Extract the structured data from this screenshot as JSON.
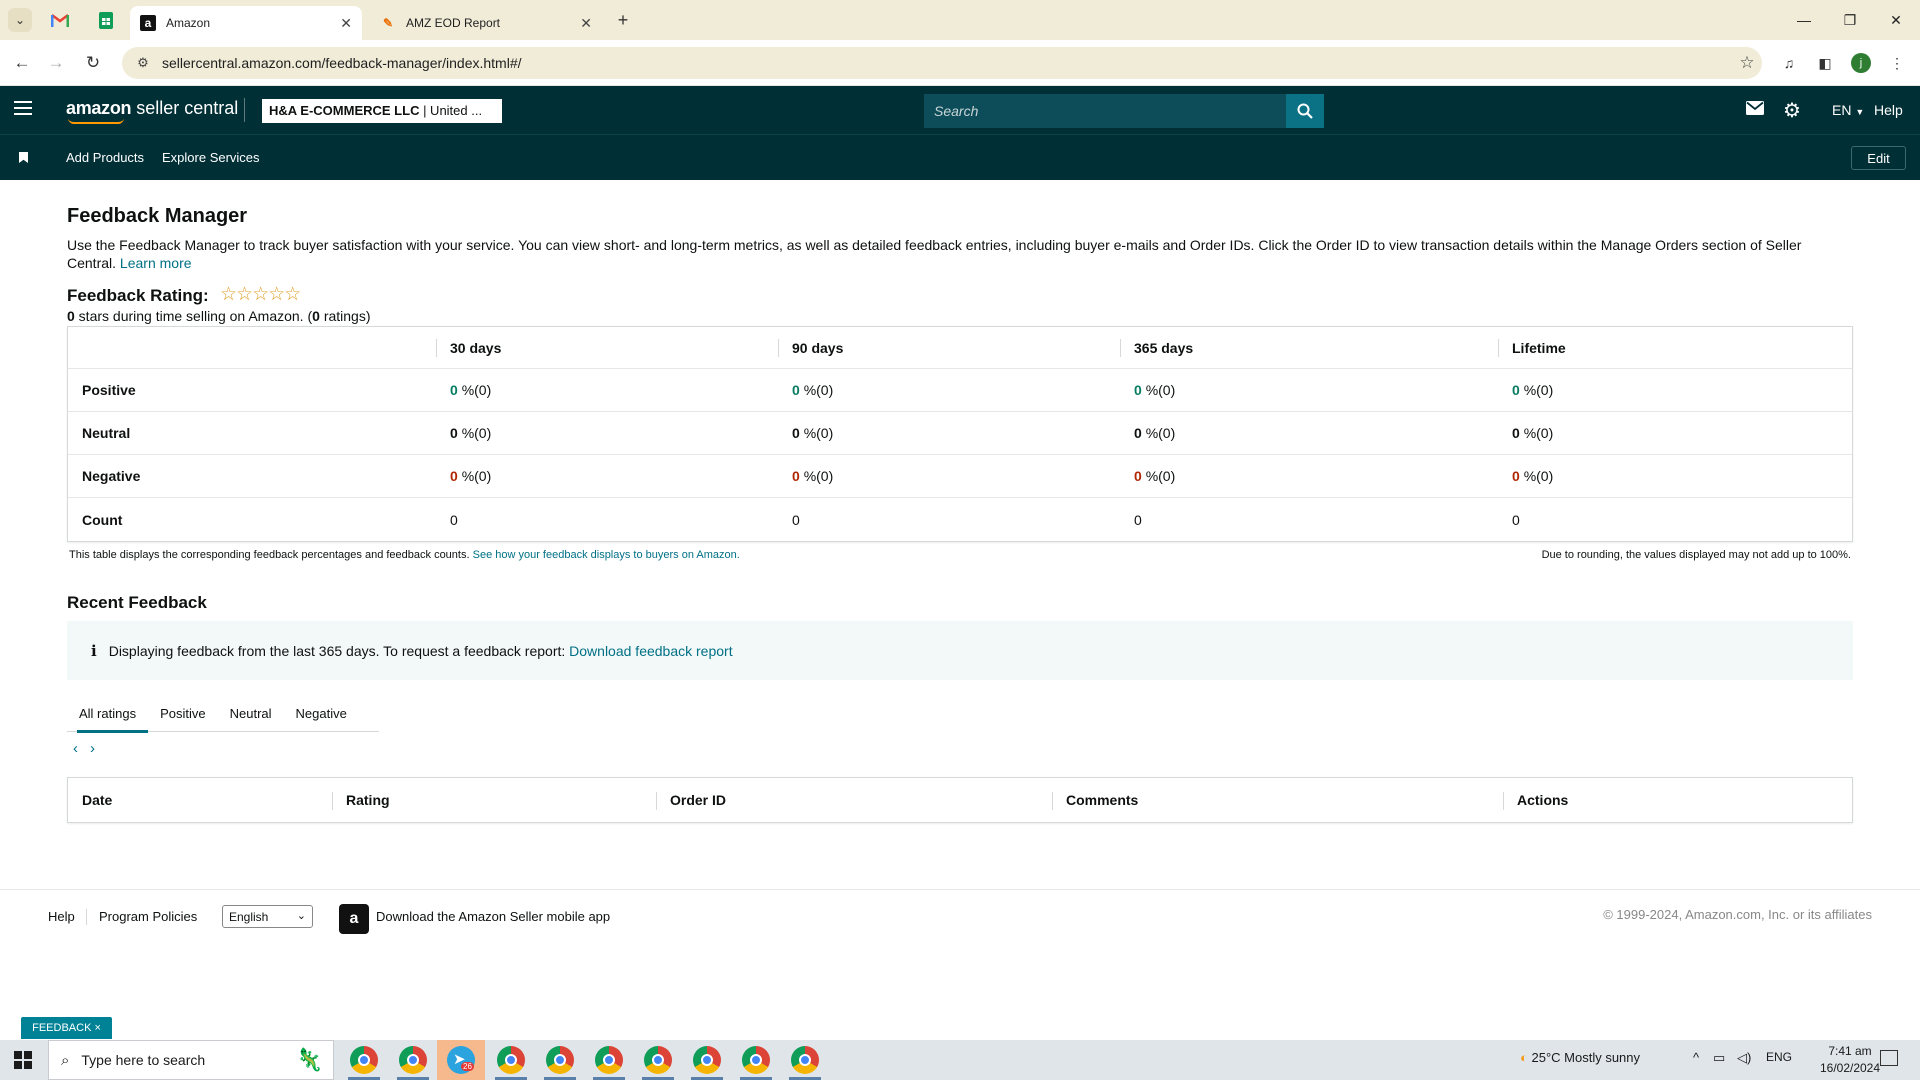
{
  "browser": {
    "tabs": [
      {
        "title": "Amazon",
        "favicon": "a"
      },
      {
        "title": "AMZ EOD Report",
        "favicon": "pencil"
      }
    ],
    "url": "sellercentral.amazon.com/feedback-manager/index.html#/",
    "profile_initial": "j"
  },
  "header": {
    "logo_bold": "amazon",
    "logo_rest": " seller central",
    "account_bold": "H&A E-COMMERCE LLC",
    "account_rest": " | United ...",
    "search_placeholder": "Search",
    "language": "EN",
    "help": "Help"
  },
  "subnav": {
    "items": [
      "Add Products",
      "Explore Services"
    ],
    "edit": "Edit"
  },
  "page": {
    "title": "Feedback Manager",
    "intro": "Use the Feedback Manager to track buyer satisfaction with your service. You can view short- and long-term metrics, as well as detailed feedback entries, including buyer e-mails and Order IDs. Click the Order ID to view transaction details within the Manage Orders section of Seller Central.",
    "learn_more": "Learn more",
    "rating_label": "Feedback Rating:",
    "stars": "☆☆☆☆☆",
    "rating_stars": 0,
    "rating_sub_value": "0",
    "rating_sub_text1": " stars during time selling on Amazon. (",
    "rating_sub_count": "0",
    "rating_sub_text2": " ratings)"
  },
  "metrics": {
    "columns": [
      "30 days",
      "90 days",
      "365 days",
      "Lifetime"
    ],
    "rows": [
      {
        "label": "Positive",
        "kind": "pos",
        "values": [
          "0",
          "0",
          "0",
          "0"
        ],
        "counts": [
          "%(0)",
          "%(0)",
          "%(0)",
          "%(0)"
        ]
      },
      {
        "label": "Neutral",
        "kind": "neu",
        "values": [
          "0",
          "0",
          "0",
          "0"
        ],
        "counts": [
          "%(0)",
          "%(0)",
          "%(0)",
          "%(0)"
        ]
      },
      {
        "label": "Negative",
        "kind": "neg",
        "values": [
          "0",
          "0",
          "0",
          "0"
        ],
        "counts": [
          "%(0)",
          "%(0)",
          "%(0)",
          "%(0)"
        ]
      }
    ],
    "count_label": "Count",
    "count_values": [
      "0",
      "0",
      "0",
      "0"
    ],
    "note": "This table displays the corresponding feedback percentages and feedback counts.",
    "note_link": "See how your feedback displays to buyers on Amazon.",
    "note_right": "Due to rounding, the values displayed may not add up to 100%."
  },
  "recent": {
    "title": "Recent Feedback",
    "info_text": "Displaying feedback from the last 365 days. To request a feedback report:",
    "info_link": "Download feedback report",
    "tabs": [
      "All ratings",
      "Positive",
      "Neutral",
      "Negative"
    ],
    "active_tab": "All ratings",
    "columns": [
      "Date",
      "Rating",
      "Order ID",
      "Comments",
      "Actions"
    ]
  },
  "footer": {
    "links": [
      "Help",
      "Program Policies"
    ],
    "language_selected": "English",
    "app_text": "Download the Amazon Seller mobile app",
    "copyright": "© 1999-2024, Amazon.com, Inc. or its affiliates"
  },
  "feedback_badge": "FEEDBACK ×",
  "taskbar": {
    "search_placeholder": "Type here to search",
    "weather": "25°C  Mostly sunny",
    "lang": "ENG",
    "time": "7:41 am",
    "date": "16/02/2024",
    "telegram_badge": "26"
  },
  "colors": {
    "header_bg": "#002f36",
    "link": "#007185",
    "positive": "#067d62",
    "negative": "#b12704",
    "star": "#e3a02c"
  }
}
